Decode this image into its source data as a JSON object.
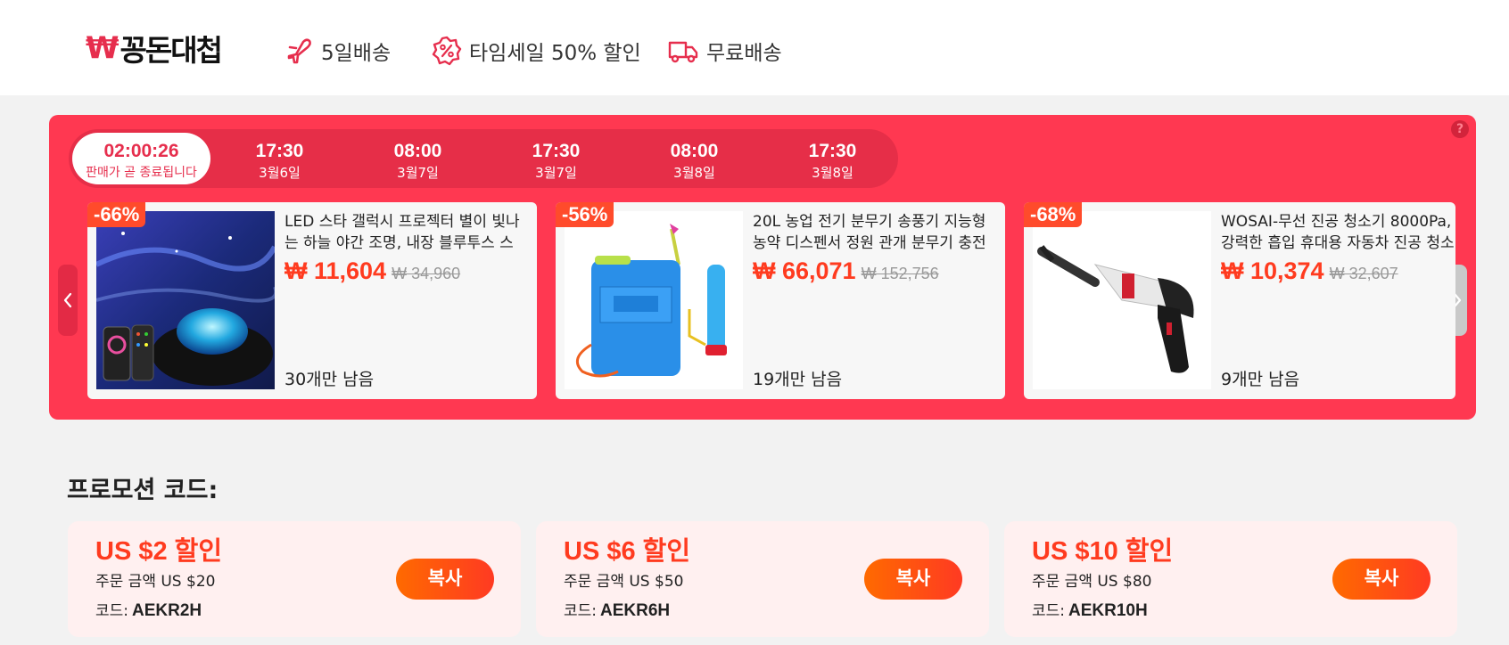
{
  "header": {
    "logo_mark": "₩",
    "logo_text": "꽁돈대첩",
    "features": [
      {
        "icon": "plane-icon",
        "label": "5일배송"
      },
      {
        "icon": "discount-badge-icon",
        "label": "타임세일 50% 할인"
      },
      {
        "icon": "truck-icon",
        "label": "무료배송"
      }
    ]
  },
  "flash_sale": {
    "help_label": "?",
    "slots": [
      {
        "time": "02:00:26",
        "date": "판매가 곧 종료됩니다",
        "active": true
      },
      {
        "time": "17:30",
        "date": "3월6일"
      },
      {
        "time": "08:00",
        "date": "3월7일"
      },
      {
        "time": "17:30",
        "date": "3월7일"
      },
      {
        "time": "08:00",
        "date": "3월8일"
      },
      {
        "time": "17:30",
        "date": "3월8일"
      }
    ],
    "products": [
      {
        "discount": "-66%",
        "title": "LED 스타 갤럭시 프로젝터 별이 빛나는 하늘 야간 조명, 내장 블루투스 스",
        "price": "₩ 11,604",
        "old_price": "₩ 34,960",
        "stock": "30개만 남음"
      },
      {
        "discount": "-56%",
        "title": "20L 농업 전기 분무기 송풍기 지능형 농약 디스펜서 정원 관개 분무기 충전",
        "price": "₩ 66,071",
        "old_price": "₩ 152,756",
        "stock": "19개만 남음"
      },
      {
        "discount": "-68%",
        "title": "WOSAI-무선 진공 청소기 8000Pa, 강력한 흡입 휴대용 자동차 진공 청소",
        "price": "₩ 10,374",
        "old_price": "₩ 32,607",
        "stock": "9개만 남음"
      }
    ]
  },
  "promo": {
    "title": "프로모션 코드:",
    "code_label": "코드:",
    "copy_label": "복사",
    "coupons": [
      {
        "amount": "US $2 할인",
        "minimum": "주문 금액 US $20",
        "code": "AEKR2H"
      },
      {
        "amount": "US $6 할인",
        "minimum": "주문 금액 US $50",
        "code": "AEKR6H"
      },
      {
        "amount": "US $10 할인",
        "minimum": "주문 금액 US $80",
        "code": "AEKR10H"
      }
    ]
  },
  "colors": {
    "brand_red": "#ff3851",
    "price_orange": "#ff3b1f",
    "copy_gradient_start": "#ff6a00"
  }
}
